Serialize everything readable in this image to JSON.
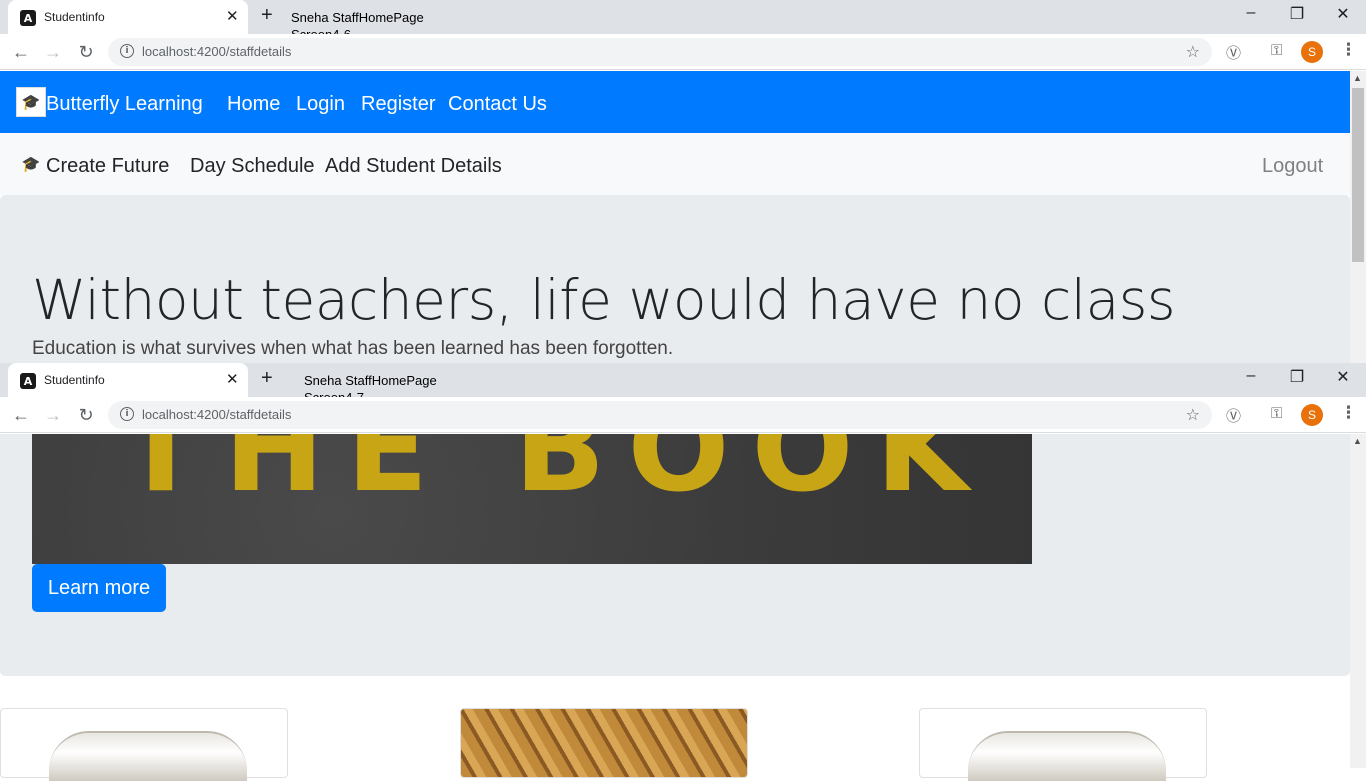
{
  "browser": {
    "tab_title": "Studentinfo",
    "url": "localhost:4200/staffdetails",
    "profile_initial": "S"
  },
  "overlay_top": {
    "line1": "Sneha StaffHomePage",
    "line2": "Screen4-6"
  },
  "overlay_bottom": {
    "line1": "Sneha StaffHomePage",
    "line2": "Screen4-7"
  },
  "navbar_primary": {
    "brand": "Butterfly Learning",
    "links": [
      "Home",
      "Login",
      "Register",
      "Contact Us"
    ]
  },
  "navbar_secondary": {
    "brand": "Create Future",
    "links": [
      "Day Schedule",
      "Add Student Details"
    ],
    "logout": "Logout"
  },
  "jumbotron": {
    "headline": "Without teachers, life would have no class",
    "lead": "Education is what survives when what has been learned has been forgotten.",
    "image_text": "THE BOOK",
    "button": "Learn more"
  },
  "colors": {
    "primary": "#007bff",
    "jumbotron_bg": "#e9ecef",
    "navbar_light": "#f8f9fa"
  },
  "icons": [
    "info-icon",
    "star-icon",
    "vivaldi-icon",
    "key-icon",
    "menu-icon"
  ]
}
